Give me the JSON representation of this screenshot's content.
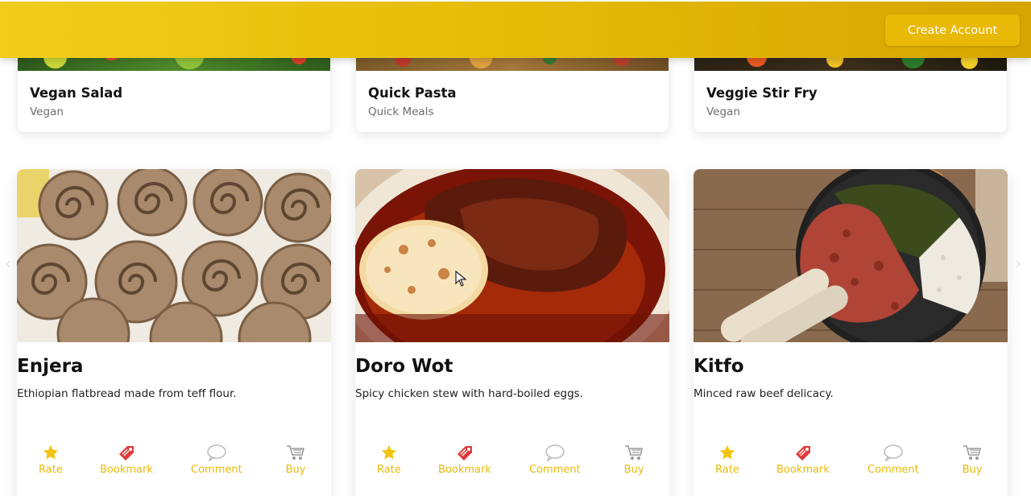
{
  "header": {
    "create_account": "Create Account"
  },
  "top_cards": [
    {
      "title": "Vegan Salad",
      "category": "Vegan"
    },
    {
      "title": "Quick Pasta",
      "category": "Quick Meals"
    },
    {
      "title": "Veggie Stir Fry",
      "category": "Vegan"
    }
  ],
  "recipes": [
    {
      "title": "Enjera",
      "description": "Ethiopian flatbread made from teff flour."
    },
    {
      "title": "Doro Wot",
      "description": "Spicy chicken stew with hard-boiled eggs."
    },
    {
      "title": "Kitfo",
      "description": "Minced raw beef delicacy."
    }
  ],
  "actions": {
    "rate": "Rate",
    "bookmark": "Bookmark",
    "comment": "Comment",
    "buy": "Buy"
  },
  "colors": {
    "brand": "#e9b908",
    "bookmark_icon": "#e03a3a"
  },
  "icons": [
    "star-icon",
    "bookmark-tag-icon",
    "comment-bubble-icon",
    "cart-icon"
  ]
}
